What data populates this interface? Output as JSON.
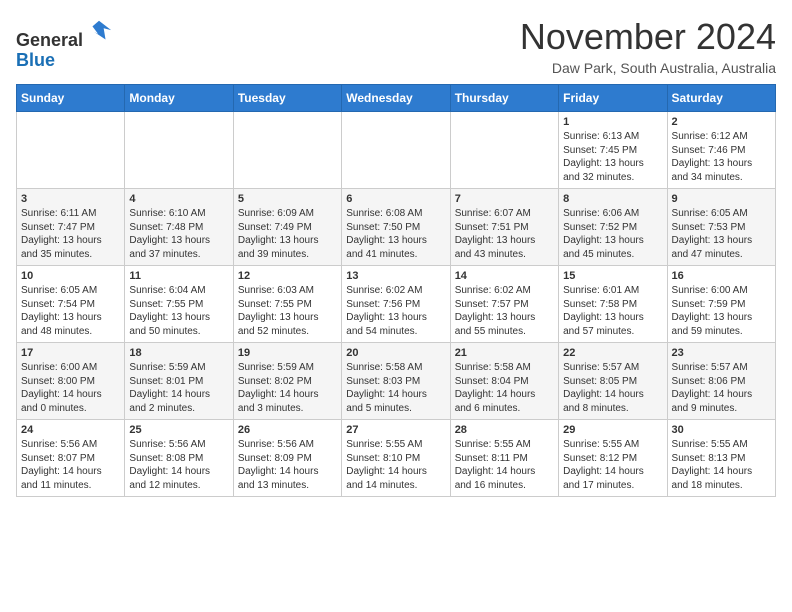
{
  "header": {
    "logo_line1": "General",
    "logo_line2": "Blue",
    "month": "November 2024",
    "location": "Daw Park, South Australia, Australia"
  },
  "weekdays": [
    "Sunday",
    "Monday",
    "Tuesday",
    "Wednesday",
    "Thursday",
    "Friday",
    "Saturday"
  ],
  "weeks": [
    [
      {
        "day": "",
        "info": ""
      },
      {
        "day": "",
        "info": ""
      },
      {
        "day": "",
        "info": ""
      },
      {
        "day": "",
        "info": ""
      },
      {
        "day": "",
        "info": ""
      },
      {
        "day": "1",
        "info": "Sunrise: 6:13 AM\nSunset: 7:45 PM\nDaylight: 13 hours\nand 32 minutes."
      },
      {
        "day": "2",
        "info": "Sunrise: 6:12 AM\nSunset: 7:46 PM\nDaylight: 13 hours\nand 34 minutes."
      }
    ],
    [
      {
        "day": "3",
        "info": "Sunrise: 6:11 AM\nSunset: 7:47 PM\nDaylight: 13 hours\nand 35 minutes."
      },
      {
        "day": "4",
        "info": "Sunrise: 6:10 AM\nSunset: 7:48 PM\nDaylight: 13 hours\nand 37 minutes."
      },
      {
        "day": "5",
        "info": "Sunrise: 6:09 AM\nSunset: 7:49 PM\nDaylight: 13 hours\nand 39 minutes."
      },
      {
        "day": "6",
        "info": "Sunrise: 6:08 AM\nSunset: 7:50 PM\nDaylight: 13 hours\nand 41 minutes."
      },
      {
        "day": "7",
        "info": "Sunrise: 6:07 AM\nSunset: 7:51 PM\nDaylight: 13 hours\nand 43 minutes."
      },
      {
        "day": "8",
        "info": "Sunrise: 6:06 AM\nSunset: 7:52 PM\nDaylight: 13 hours\nand 45 minutes."
      },
      {
        "day": "9",
        "info": "Sunrise: 6:05 AM\nSunset: 7:53 PM\nDaylight: 13 hours\nand 47 minutes."
      }
    ],
    [
      {
        "day": "10",
        "info": "Sunrise: 6:05 AM\nSunset: 7:54 PM\nDaylight: 13 hours\nand 48 minutes."
      },
      {
        "day": "11",
        "info": "Sunrise: 6:04 AM\nSunset: 7:55 PM\nDaylight: 13 hours\nand 50 minutes."
      },
      {
        "day": "12",
        "info": "Sunrise: 6:03 AM\nSunset: 7:55 PM\nDaylight: 13 hours\nand 52 minutes."
      },
      {
        "day": "13",
        "info": "Sunrise: 6:02 AM\nSunset: 7:56 PM\nDaylight: 13 hours\nand 54 minutes."
      },
      {
        "day": "14",
        "info": "Sunrise: 6:02 AM\nSunset: 7:57 PM\nDaylight: 13 hours\nand 55 minutes."
      },
      {
        "day": "15",
        "info": "Sunrise: 6:01 AM\nSunset: 7:58 PM\nDaylight: 13 hours\nand 57 minutes."
      },
      {
        "day": "16",
        "info": "Sunrise: 6:00 AM\nSunset: 7:59 PM\nDaylight: 13 hours\nand 59 minutes."
      }
    ],
    [
      {
        "day": "17",
        "info": "Sunrise: 6:00 AM\nSunset: 8:00 PM\nDaylight: 14 hours\nand 0 minutes."
      },
      {
        "day": "18",
        "info": "Sunrise: 5:59 AM\nSunset: 8:01 PM\nDaylight: 14 hours\nand 2 minutes."
      },
      {
        "day": "19",
        "info": "Sunrise: 5:59 AM\nSunset: 8:02 PM\nDaylight: 14 hours\nand 3 minutes."
      },
      {
        "day": "20",
        "info": "Sunrise: 5:58 AM\nSunset: 8:03 PM\nDaylight: 14 hours\nand 5 minutes."
      },
      {
        "day": "21",
        "info": "Sunrise: 5:58 AM\nSunset: 8:04 PM\nDaylight: 14 hours\nand 6 minutes."
      },
      {
        "day": "22",
        "info": "Sunrise: 5:57 AM\nSunset: 8:05 PM\nDaylight: 14 hours\nand 8 minutes."
      },
      {
        "day": "23",
        "info": "Sunrise: 5:57 AM\nSunset: 8:06 PM\nDaylight: 14 hours\nand 9 minutes."
      }
    ],
    [
      {
        "day": "24",
        "info": "Sunrise: 5:56 AM\nSunset: 8:07 PM\nDaylight: 14 hours\nand 11 minutes."
      },
      {
        "day": "25",
        "info": "Sunrise: 5:56 AM\nSunset: 8:08 PM\nDaylight: 14 hours\nand 12 minutes."
      },
      {
        "day": "26",
        "info": "Sunrise: 5:56 AM\nSunset: 8:09 PM\nDaylight: 14 hours\nand 13 minutes."
      },
      {
        "day": "27",
        "info": "Sunrise: 5:55 AM\nSunset: 8:10 PM\nDaylight: 14 hours\nand 14 minutes."
      },
      {
        "day": "28",
        "info": "Sunrise: 5:55 AM\nSunset: 8:11 PM\nDaylight: 14 hours\nand 16 minutes."
      },
      {
        "day": "29",
        "info": "Sunrise: 5:55 AM\nSunset: 8:12 PM\nDaylight: 14 hours\nand 17 minutes."
      },
      {
        "day": "30",
        "info": "Sunrise: 5:55 AM\nSunset: 8:13 PM\nDaylight: 14 hours\nand 18 minutes."
      }
    ]
  ]
}
